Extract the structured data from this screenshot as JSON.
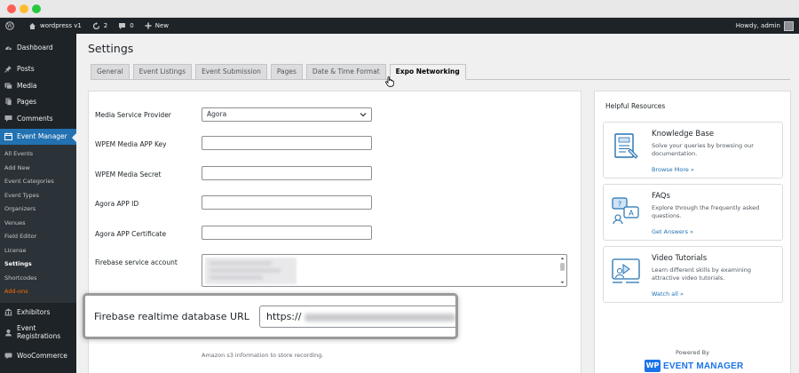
{
  "admin_bar": {
    "site_name": "wordpress v1",
    "updates_count": "2",
    "comments_count": "0",
    "new_label": "New",
    "greeting": "Howdy, admin"
  },
  "sidebar": {
    "top_items": [
      {
        "label": "Dashboard",
        "icon": "dashboard-icon"
      }
    ],
    "main_items": [
      {
        "label": "Posts",
        "icon": "pin-icon"
      },
      {
        "label": "Media",
        "icon": "media-icon"
      },
      {
        "label": "Pages",
        "icon": "pages-icon"
      },
      {
        "label": "Comments",
        "icon": "comments-icon"
      }
    ],
    "current": {
      "label": "Event Manager",
      "icon": "calendar-icon"
    },
    "submenu": [
      "All Events",
      "Add New",
      "Event Categories",
      "Event Types",
      "Organizers",
      "Venues",
      "Field Editor",
      "License",
      "Settings",
      "Shortcodes",
      "Add-ons"
    ],
    "bottom_items": [
      {
        "label": "Exhibitors",
        "icon": "exhibitors-icon"
      },
      {
        "label": "Event Registrations",
        "icon": "registrations-icon"
      },
      {
        "label": "WooCommerce",
        "icon": "woocommerce-icon"
      }
    ]
  },
  "page": {
    "title": "Settings",
    "tabs": [
      "General",
      "Event Listings",
      "Event Submission",
      "Pages",
      "Date & Time Format",
      "Expo Networking"
    ],
    "active_tab": "Expo Networking"
  },
  "form": {
    "media_provider": {
      "label": "Media Service Provider",
      "value": "Agora"
    },
    "app_key": {
      "label": "WPEM Media APP Key",
      "value": ""
    },
    "app_secret": {
      "label": "WPEM Media Secret",
      "value": ""
    },
    "agora_app_id": {
      "label": "Agora APP ID",
      "value": ""
    },
    "agora_cert": {
      "label": "Agora APP Certificate",
      "value": ""
    },
    "firebase_account": {
      "label": "Firebase service account"
    },
    "firebase_db_url": {
      "label": "Firebase realtime database URL",
      "value_prefix": "https://"
    },
    "s3_hint": "Amazon s3 information to store recording."
  },
  "resources": {
    "title": "Helpful Resources",
    "cards": [
      {
        "name": "Knowledge Base",
        "desc": "Solve your queries by browsing our documentation.",
        "link": "Browse More »",
        "icon": "knowledge-base-icon"
      },
      {
        "name": "FAQs",
        "desc": "Explore through the frequently asked questions.",
        "link": "Get Answers »",
        "icon": "faq-icon"
      },
      {
        "name": "Video Tutorials",
        "desc": "Learn different skills by examining attractive video tutorials.",
        "link": "Watch all »",
        "icon": "video-tutorial-icon"
      }
    ],
    "powered_by": "Powered By",
    "logo_badge": "WP",
    "logo_text": "EVENT MANAGER"
  },
  "colors": {
    "admin_dark": "#1d2327",
    "accent_blue": "#2271b1",
    "addons_orange": "#ff6a00",
    "brand_blue": "#1a73e8"
  }
}
